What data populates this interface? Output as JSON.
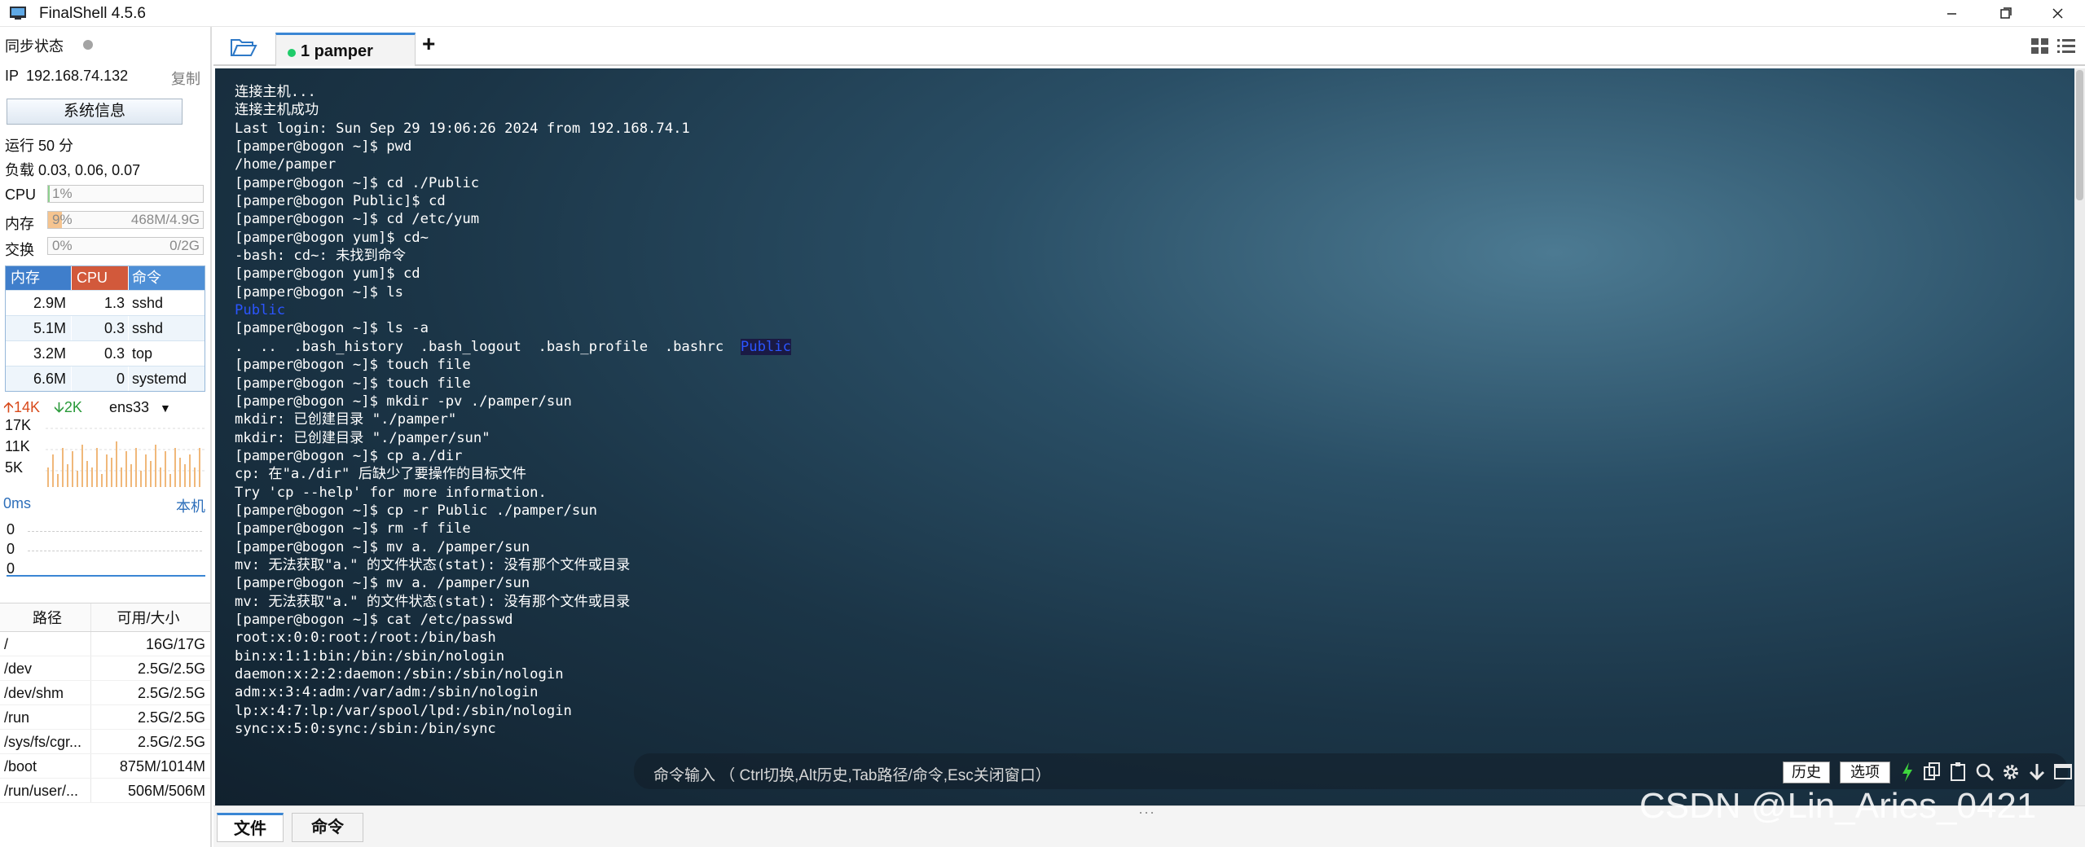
{
  "app": {
    "title": "FinalShell 4.5.6"
  },
  "sidebar": {
    "sync_label": "同步状态",
    "ip_label": "IP",
    "ip": "192.168.74.132",
    "copy_label": "复制",
    "sysinfo_button": "系统信息",
    "uptime": "运行 50 分",
    "load": "负载 0.03, 0.06, 0.07",
    "cpu": {
      "label": "CPU",
      "value": "1%",
      "fill": 0.01
    },
    "mem": {
      "label": "内存",
      "value": "9%",
      "detail": "468M/4.9G",
      "fill": 0.09
    },
    "swap": {
      "label": "交换",
      "value": "0%",
      "detail": "0/2G",
      "fill": 0.0
    },
    "process_table": {
      "headers": [
        "内存",
        "CPU",
        "命令"
      ],
      "rows": [
        {
          "mem": "2.9M",
          "cpu": "1.3",
          "cmd": "sshd"
        },
        {
          "mem": "5.1M",
          "cpu": "0.3",
          "cmd": "sshd"
        },
        {
          "mem": "3.2M",
          "cpu": "0.3",
          "cmd": "top"
        },
        {
          "mem": "6.6M",
          "cpu": "0",
          "cmd": "systemd"
        }
      ]
    },
    "net": {
      "up": "14K",
      "down": "2K",
      "iface": "ens33",
      "y_ticks": [
        "17K",
        "11K",
        "5K"
      ]
    },
    "latency": {
      "label": "0ms",
      "target": "本机",
      "values": [
        "0",
        "0",
        "0"
      ]
    },
    "disk": {
      "headers": [
        "路径",
        "可用/大小"
      ],
      "rows": [
        {
          "path": "/",
          "size": "16G/17G"
        },
        {
          "path": "/dev",
          "size": "2.5G/2.5G"
        },
        {
          "path": "/dev/shm",
          "size": "2.5G/2.5G"
        },
        {
          "path": "/run",
          "size": "2.5G/2.5G"
        },
        {
          "path": "/sys/fs/cgr...",
          "size": "2.5G/2.5G"
        },
        {
          "path": "/boot",
          "size": "875M/1014M"
        },
        {
          "path": "/run/user/...",
          "size": "506M/506M"
        }
      ]
    }
  },
  "tabs": [
    {
      "label": "1 pamper",
      "active": true
    }
  ],
  "terminal": {
    "lines": [
      "连接主机...",
      "连接主机成功",
      "Last login: Sun Sep 29 19:06:26 2024 from 192.168.74.1",
      "[pamper@bogon ~]$ pwd",
      "/home/pamper",
      "[pamper@bogon ~]$ cd ./Public",
      "[pamper@bogon Public]$ cd",
      "[pamper@bogon ~]$ cd /etc/yum",
      "[pamper@bogon yum]$ cd~",
      "-bash: cd~: 未找到命令",
      "[pamper@bogon yum]$ cd",
      "[pamper@bogon ~]$ ls",
      "Public",
      "[pamper@bogon ~]$ ls -a",
      ".  ..  .bash_history  .bash_logout  .bash_profile  .bashrc  Public",
      "[pamper@bogon ~]$ touch file",
      "[pamper@bogon ~]$ touch file",
      "[pamper@bogon ~]$ mkdir -pv ./pamper/sun",
      "mkdir: 已创建目录 \"./pamper\"",
      "mkdir: 已创建目录 \"./pamper/sun\"",
      "[pamper@bogon ~]$ cp a./dir",
      "cp: 在\"a./dir\" 后缺少了要操作的目标文件",
      "Try 'cp --help' for more information.",
      "[pamper@bogon ~]$ cp -r Public ./pamper/sun",
      "[pamper@bogon ~]$ rm -f file",
      "[pamper@bogon ~]$ mv a. /pamper/sun",
      "mv: 无法获取\"a.\" 的文件状态(stat): 没有那个文件或目录",
      "[pamper@bogon ~]$ mv a. /pamper/sun",
      "mv: 无法获取\"a.\" 的文件状态(stat): 没有那个文件或目录",
      "[pamper@bogon ~]$ cat /etc/passwd",
      "root:x:0:0:root:/root:/bin/bash",
      "bin:x:1:1:bin:/bin:/sbin/nologin",
      "daemon:x:2:2:daemon:/sbin:/sbin/nologin",
      "adm:x:3:4:adm:/var/adm:/sbin/nologin",
      "lp:x:4:7:lp:/var/spool/lpd:/sbin/nologin",
      "sync:x:5:0:sync:/sbin:/bin/sync"
    ],
    "ls_a_prefix": ".  ..  .bash_history  .bash_logout  .bash_profile  .bashrc  ",
    "ls_a_public": "Public"
  },
  "command_bar": {
    "placeholder": "命令输入 （ Ctrl切换,Alt历史,Tab路径/命令,Esc关闭窗口）",
    "history_button": "历史",
    "options_button": "选项"
  },
  "bottom_tabs": [
    "文件",
    "命令"
  ],
  "watermark": "CSDN @Lin_Aries_0421",
  "colors": {
    "accent": "#3a86d4",
    "proc_mem": "#3f7ecb",
    "proc_cpu": "#d2593b",
    "proc_cmd": "#4e8fd6",
    "net_up": "#d84a1b",
    "net_down": "#2a9a3a",
    "ls_dir": "#2b55ff"
  }
}
